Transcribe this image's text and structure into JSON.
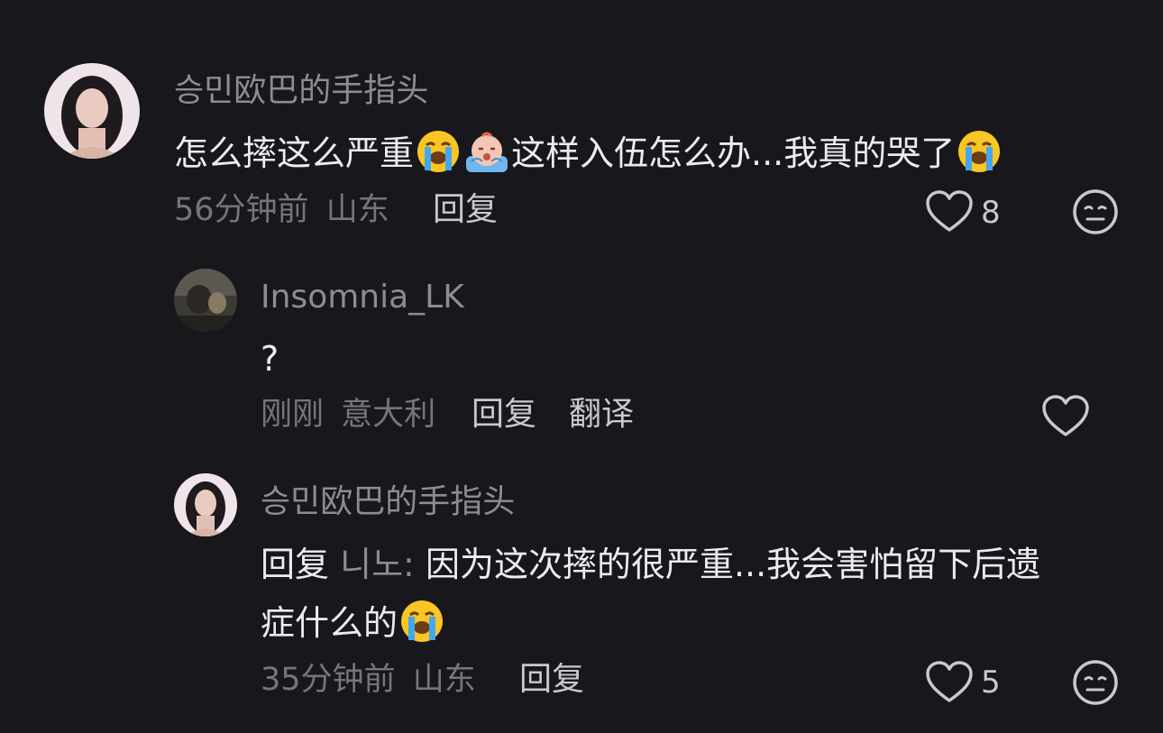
{
  "comments": [
    {
      "username": "승민欧巴的手指头",
      "text_part1": "怎么摔这么严重",
      "text_part2": "这样入伍怎么办...我真的哭了",
      "time": "56分钟前",
      "location": "山东",
      "reply_label": "回复",
      "likes": "8"
    },
    {
      "username": "Insomnia_LK",
      "text": "?",
      "time": "刚刚",
      "location": "意大利",
      "reply_label": "回复",
      "translate_label": "翻译"
    },
    {
      "username": "승민欧巴的手指头",
      "reply_prefix": "回复",
      "reply_target": "니노:",
      "text_line1": "因为这次摔的很严重...我会害怕留下后遗",
      "text_line2": "症什么的",
      "time": "35分钟前",
      "location": "山东",
      "reply_label": "回复",
      "likes": "5"
    }
  ],
  "icons": {
    "loudly_crying": "loudly-crying-face-emoji",
    "crying_baby": "crying-baby-emoji",
    "heart": "heart-outline-icon",
    "dislike": "expressionless-face-icon"
  },
  "colors": {
    "background": "#18171c",
    "username": "#8d8c92",
    "body_text": "#ececef",
    "meta": "#76757b"
  }
}
